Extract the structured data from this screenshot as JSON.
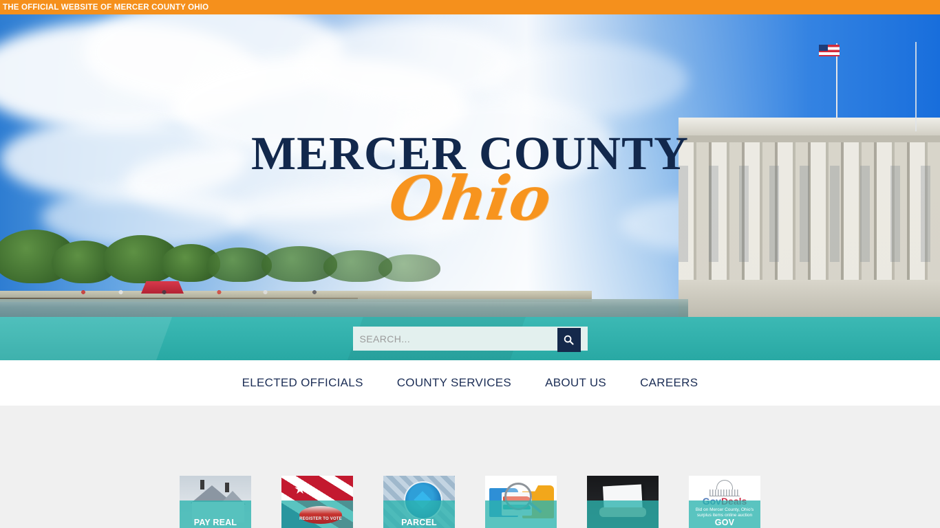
{
  "topbar": {
    "text": "THE OFFICIAL WEBSITE OF MERCER COUNTY OHIO",
    "bg": "#F5901C"
  },
  "hero": {
    "title": "MERCER COUNTY",
    "script": "Ohio",
    "title_color": "#12284C",
    "script_color": "#F7941E"
  },
  "search": {
    "placeholder": "SEARCH...",
    "value": "",
    "button_icon": "search-icon",
    "band_color": "#2BB3AE",
    "button_color": "#15294B"
  },
  "nav": {
    "items": [
      {
        "label": "ELECTED OFFICIALS"
      },
      {
        "label": "COUNTY SERVICES"
      },
      {
        "label": "ABOUT US"
      },
      {
        "label": "CAREERS"
      }
    ],
    "text_color": "#1B2D55"
  },
  "tiles": {
    "section_bg": "#F0F0F0",
    "overlay_color": "#2BB3AE",
    "items": [
      {
        "label": "PAY REAL",
        "art": "house-photo"
      },
      {
        "label": "",
        "art": "flag-register-to-vote",
        "badge": "REGISTER TO VOTE"
      },
      {
        "label": "PARCEL",
        "art": "parcel-magnifier"
      },
      {
        "label": "",
        "art": "folders-magnifier"
      },
      {
        "label": "",
        "art": "documents-photo"
      },
      {
        "label": "GOV",
        "art": "govdeals-logo",
        "logo_a": "Gov",
        "logo_b": "Deals",
        "logo_sub": "Bid on Mercer County, Ohio's surplus items online auction"
      }
    ]
  }
}
